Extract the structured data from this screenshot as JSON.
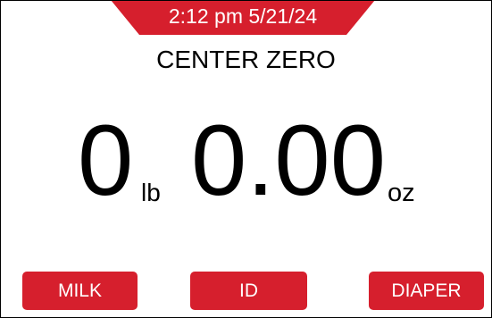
{
  "colors": {
    "accent": "#d61f2d",
    "text": "#000000",
    "background": "#ffffff"
  },
  "header": {
    "datetime": "2:12 pm 5/21/24"
  },
  "status": {
    "message": "CENTER ZERO"
  },
  "weight": {
    "pounds": "0",
    "pounds_unit": "lb",
    "ounces": "0.00",
    "ounces_unit": "oz"
  },
  "actions": {
    "milk_label": "MILK",
    "id_label": "ID",
    "diaper_label": "DIAPER"
  }
}
